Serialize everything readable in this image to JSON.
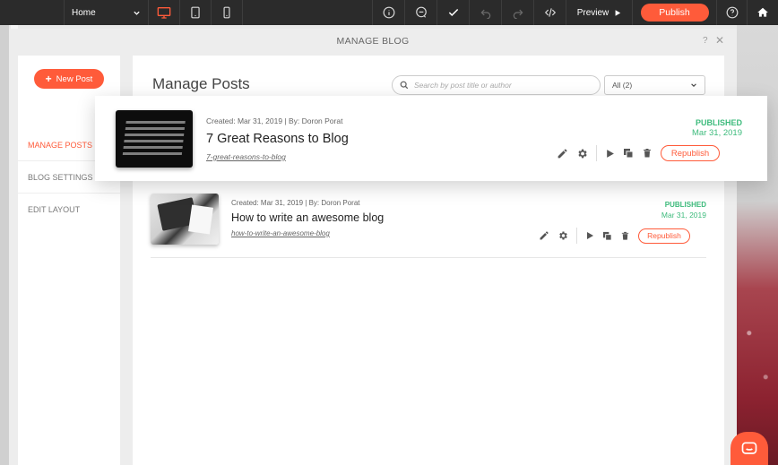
{
  "toolbar": {
    "page_selector": "Home",
    "preview_label": "Preview",
    "publish_label": "Publish"
  },
  "modal": {
    "title": "MANAGE BLOG",
    "help": "?",
    "close": "✕"
  },
  "sidebar": {
    "new_post_label": "New Post",
    "items": [
      {
        "label": "MANAGE POSTS",
        "active": true
      },
      {
        "label": "BLOG SETTINGS",
        "active": false
      },
      {
        "label": "EDIT LAYOUT",
        "active": false
      }
    ]
  },
  "main": {
    "title": "Manage Posts",
    "search_placeholder": "Search by post title or author",
    "filter_value": "All (2)"
  },
  "posts": [
    {
      "meta": "Created: Mar 31, 2019 | By: Doron Porat",
      "title": "7 Great Reasons to Blog",
      "slug": "7-great-reasons-to-blog",
      "status": "PUBLISHED",
      "date": "Mar 31, 2019",
      "action_label": "Republish"
    },
    {
      "meta": "Created: Mar 31, 2019 | By: Doron Porat",
      "title": "How to write an awesome blog",
      "slug": "how-to-write-an-awesome-blog",
      "status": "PUBLISHED",
      "date": "Mar 31, 2019",
      "action_label": "Republish"
    }
  ],
  "colors": {
    "accent": "#ff5b3a",
    "published": "#3dbb7c",
    "toolbar": "#2b2b2b"
  }
}
